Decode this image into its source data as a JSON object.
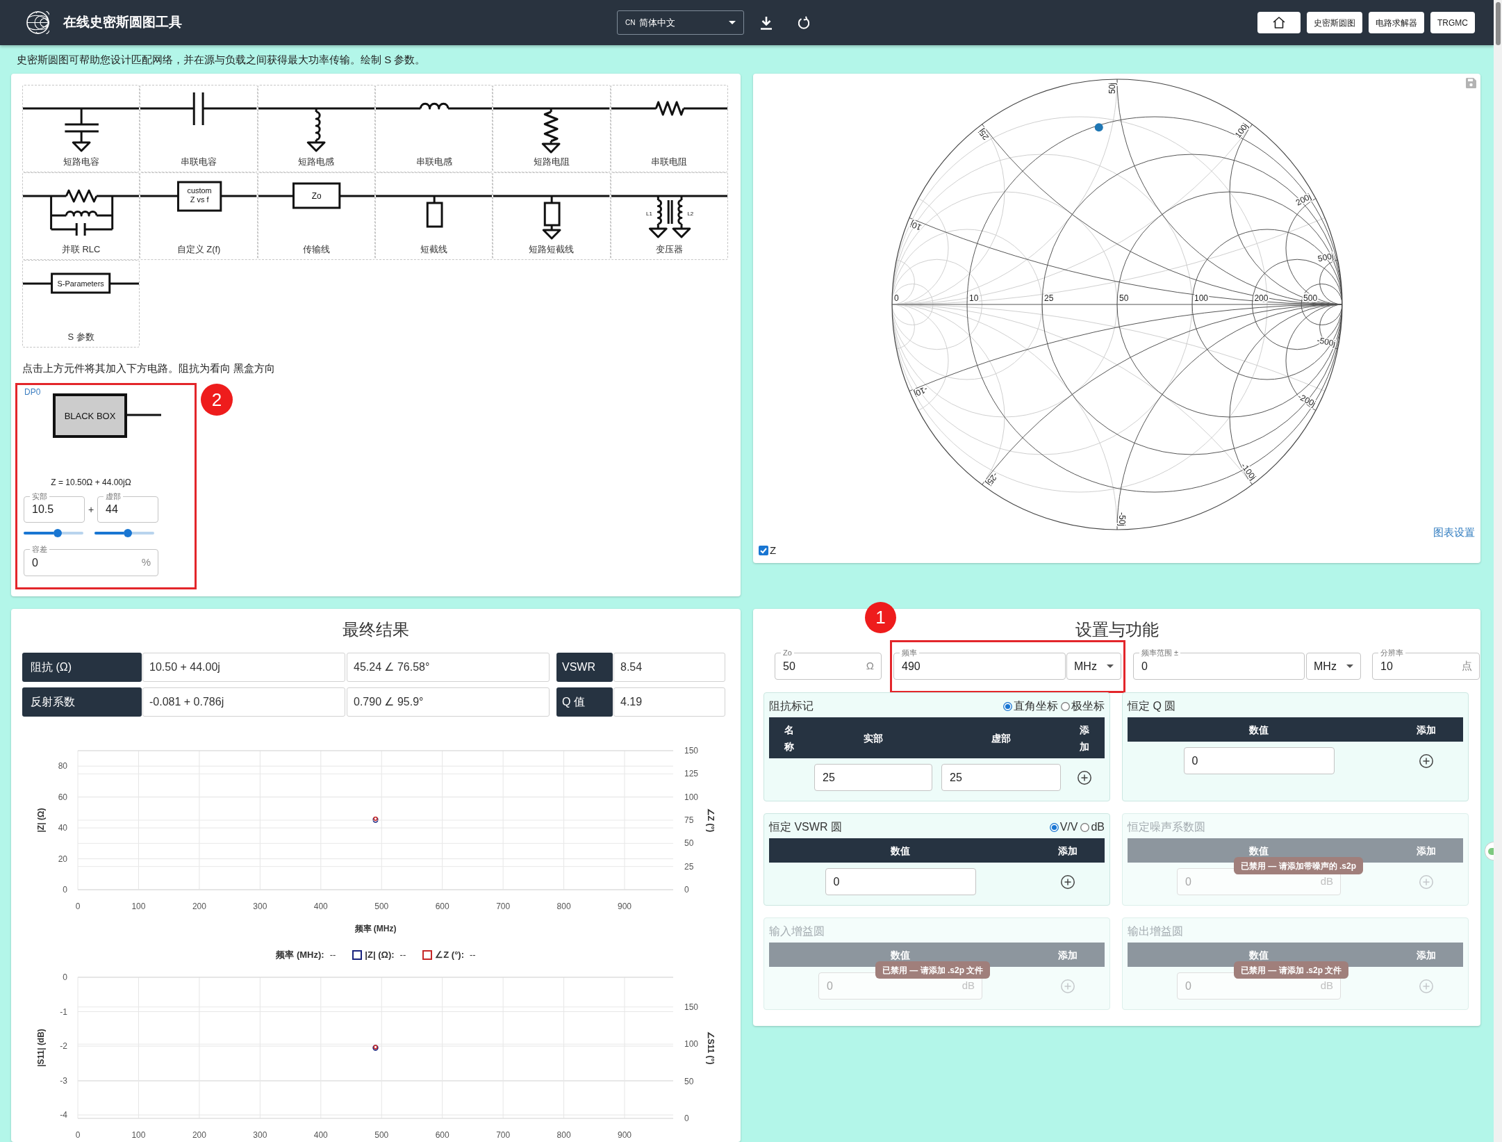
{
  "header": {
    "title": "在线史密斯圆图工具",
    "language": {
      "code": "CN",
      "label": "简体中文"
    },
    "nav": [
      {
        "kind": "home"
      },
      {
        "kind": "link",
        "label": "史密斯圆图"
      },
      {
        "kind": "link",
        "label": "电路求解器"
      },
      {
        "kind": "link",
        "label": "TRGMC"
      }
    ]
  },
  "intro": "史密斯圆图可帮助您设计匹配网络，并在源与负载之间获得最大功率传输。绘制 S 参数。",
  "palette": {
    "components": [
      {
        "kind": "shunt_capacitor",
        "label": "短路电容"
      },
      {
        "kind": "series_capacitor",
        "label": "串联电容"
      },
      {
        "kind": "shunt_inductor",
        "label": "短路电感"
      },
      {
        "kind": "series_inductor",
        "label": "串联电感"
      },
      {
        "kind": "shunt_resistor",
        "label": "短路电阻"
      },
      {
        "kind": "series_resistor",
        "label": "串联电阻"
      },
      {
        "kind": "parallel_rlc",
        "label": "并联 RLC"
      },
      {
        "kind": "custom_z",
        "label": "自定义 Z(f)",
        "text": [
          "custom",
          "Z vs f"
        ]
      },
      {
        "kind": "transmission_line",
        "label": "传输线",
        "text": [
          "Zo"
        ]
      },
      {
        "kind": "stub",
        "label": "短截线"
      },
      {
        "kind": "shorted_stub",
        "label": "短路短截线"
      },
      {
        "kind": "transformer",
        "label": "变压器",
        "text": [
          "L1",
          "L2"
        ]
      },
      {
        "kind": "s_parameters",
        "label": "S 参数",
        "text": [
          "S-Parameters"
        ]
      }
    ],
    "hint": "点击上方元件将其加入下方电路。阻抗为看向 黑盒方向"
  },
  "circuit": {
    "badge": "2",
    "port": "DP0",
    "box_label": "BLACK BOX",
    "impedance": "Z = 10.50Ω + 44.00jΩ",
    "real": {
      "label": "实部",
      "value": "10.5",
      "level": 0.5
    },
    "joiner": "+",
    "imag": {
      "label": "虚部",
      "value": "44",
      "level": 0.49
    },
    "tolerance": {
      "label": "容差",
      "value": "0",
      "unit": "%"
    }
  },
  "smith_chart": {
    "resistance_labels": [
      "0",
      "10",
      "25",
      "50",
      "100",
      "200",
      "500"
    ],
    "reactance_labels": [
      "10j",
      "25j",
      "50j",
      "100j",
      "200j",
      "500j",
      "-10j",
      "-25j",
      "-50j",
      "-100j",
      "-200j",
      "-500j"
    ],
    "trace": {
      "label": "Z",
      "checked": true
    },
    "settings_link": "图表设置"
  },
  "results": {
    "title": "最终结果",
    "rows": [
      {
        "label": "阻抗 (Ω)",
        "values": [
          "10.50 + 44.00j",
          "45.24 ∠ 76.58°"
        ],
        "metric": "VSWR",
        "metric_value": "8.54"
      },
      {
        "label": "反射系数",
        "values": [
          "-0.081 + 0.786j",
          "0.790 ∠ 95.9°"
        ],
        "metric": "Q 值",
        "metric_value": "4.19"
      }
    ],
    "impedance_plot": {
      "magnitude": {
        "chart_data": {
          "type": "scatter",
          "xlabel": "频率 (MHz)",
          "x": [
            490
          ],
          "series": [
            {
              "name": "|Z| (Ω)",
              "color": "#1a237e",
              "values": [
                45.2
              ]
            }
          ],
          "xlim": [
            0,
            980
          ],
          "ylim": [
            0,
            90
          ],
          "xticks": [
            0,
            100,
            200,
            300,
            400,
            500,
            600,
            700,
            800,
            900
          ],
          "yticks": [
            0,
            20,
            40,
            60,
            80
          ],
          "grid": true
        }
      },
      "phase": {
        "chart_data": {
          "type": "scatter",
          "x": [
            490
          ],
          "series": [
            {
              "name": "∠Z (°)",
              "color": "#c62828",
              "values": [
                76.6
              ]
            }
          ],
          "xlim": [
            0,
            980
          ],
          "ylim": [
            0,
            150
          ],
          "yticks": [
            0,
            25,
            50,
            75,
            100,
            125,
            150
          ],
          "grid": true
        }
      }
    },
    "readout": [
      {
        "label": "频率 (MHz):",
        "value": "--"
      },
      {
        "label": "|Z| (Ω):",
        "value": "--",
        "color": "#1a237e"
      },
      {
        "label": "∠Z (°):",
        "value": "--",
        "color": "#c62828"
      }
    ],
    "s11_plot": {
      "magnitude": {
        "chart_data": {
          "type": "scatter",
          "x": [
            490
          ],
          "series": [
            {
              "name": "|S11| (dB)",
              "color": "#1a237e",
              "values": [
                -2.05
              ]
            }
          ],
          "xlim": [
            0,
            980
          ],
          "ylim": [
            -4.1,
            0
          ],
          "xticks": [
            0,
            100,
            200,
            300,
            400,
            500,
            600,
            700,
            800,
            900
          ],
          "yticks": [
            -4,
            -3,
            -2,
            -1,
            0
          ],
          "grid": true
        }
      },
      "phase": {
        "chart_data": {
          "type": "scatter",
          "x": [
            490
          ],
          "series": [
            {
              "name": "∠S11 (°)",
              "color": "#c62828",
              "values": [
                96
              ]
            }
          ],
          "xlim": [
            0,
            980
          ],
          "ylim": [
            0,
            190
          ],
          "yticks": [
            0,
            50,
            100,
            150
          ],
          "grid": true
        }
      }
    }
  },
  "settings": {
    "badge": "1",
    "title": "设置与功能",
    "fields": [
      {
        "kind": "plain",
        "label": "Zo",
        "value": "50",
        "unit": "Ω"
      },
      {
        "kind": "framed",
        "label": "频率",
        "value": "490",
        "select": "MHz"
      },
      {
        "kind": "plain",
        "label": "频率范围 ±",
        "value": "0",
        "select": "MHz"
      },
      {
        "kind": "plain",
        "label": "分辨率",
        "value": "10",
        "unit": "点"
      }
    ],
    "panels": [
      {
        "kind": "marker",
        "title": "阻抗标记",
        "disabled": false,
        "options": [
          {
            "label": "直角坐标",
            "selected": true
          },
          {
            "label": "极坐标",
            "selected": false
          }
        ],
        "columns": [
          "名称",
          "实部",
          "虚部",
          "添加"
        ],
        "inputs": [
          {
            "value": "25"
          },
          {
            "value": "25"
          }
        ]
      },
      {
        "kind": "circle",
        "title": "恒定 Q 圆",
        "disabled": false,
        "columns": [
          "数值",
          "添加"
        ],
        "inputs": [
          {
            "value": "0"
          }
        ]
      },
      {
        "kind": "circle",
        "title": "恒定 VSWR 圆",
        "disabled": false,
        "options": [
          {
            "label": "V/V",
            "selected": true
          },
          {
            "label": "dB",
            "selected": false
          }
        ],
        "columns": [
          "数值",
          "添加"
        ],
        "inputs": [
          {
            "value": "0"
          }
        ]
      },
      {
        "kind": "circle",
        "title": "恒定噪声系数圆",
        "disabled": true,
        "columns": [
          "数值",
          "添加"
        ],
        "inputs": [
          {
            "value": "0",
            "unit": "dB"
          }
        ],
        "tooltip": "已禁用 — 请添加带噪声的 .s2p"
      },
      {
        "kind": "circle",
        "title": "输入增益圆",
        "disabled": true,
        "columns": [
          "数值",
          "添加"
        ],
        "inputs": [
          {
            "value": "0",
            "unit": "dB"
          }
        ],
        "tooltip": "已禁用 — 请添加 .s2p 文件"
      },
      {
        "kind": "circle",
        "title": "输出增益圆",
        "disabled": true,
        "columns": [
          "数值",
          "添加"
        ],
        "inputs": [
          {
            "value": "0",
            "unit": "dB"
          }
        ],
        "tooltip": "已禁用 — 请添加 .s2p 文件"
      }
    ]
  }
}
